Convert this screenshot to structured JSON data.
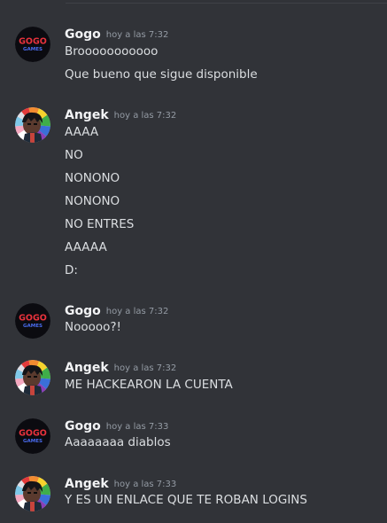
{
  "groups": [
    {
      "author": "Gogo",
      "avatar": "gogo-games-logo",
      "avatar_text": [
        "GOGO",
        "GAMES"
      ],
      "timestamp": "hoy a las 7:32",
      "messages": [
        "Brooooooooooo",
        "Que bueno que sigue disponible"
      ]
    },
    {
      "author": "Angek",
      "avatar": "angek-character-avatar",
      "timestamp": "hoy a las 7:32",
      "messages": [
        "AAAA",
        "NO",
        "NONONO",
        "NONONO",
        "NO ENTRES",
        "AAAAA",
        "D:"
      ]
    },
    {
      "author": "Gogo",
      "avatar": "gogo-games-logo",
      "avatar_text": [
        "GOGO",
        "GAMES"
      ],
      "timestamp": "hoy a las 7:32",
      "messages": [
        "Nooooo?!"
      ]
    },
    {
      "author": "Angek",
      "avatar": "angek-character-avatar",
      "timestamp": "hoy a las 7:32",
      "messages": [
        "ME HACKEARON LA CUENTA"
      ]
    },
    {
      "author": "Gogo",
      "avatar": "gogo-games-logo",
      "avatar_text": [
        "GOGO",
        "GAMES"
      ],
      "timestamp": "hoy a las 7:33",
      "messages": [
        "Aaaaaaaa diablos"
      ]
    },
    {
      "author": "Angek",
      "avatar": "angek-character-avatar",
      "timestamp": "hoy a las 7:33",
      "messages": [
        "Y ES UN ENLACE QUE TE ROBAN LOGINS"
      ]
    }
  ],
  "colors": {
    "background": "#313338",
    "username": "#f2f3f5",
    "timestamp": "#949ba4",
    "message_text": "#dbdee1",
    "gogo_logo_red": "#e8323c",
    "gogo_logo_blue": "#4a6cf0"
  }
}
